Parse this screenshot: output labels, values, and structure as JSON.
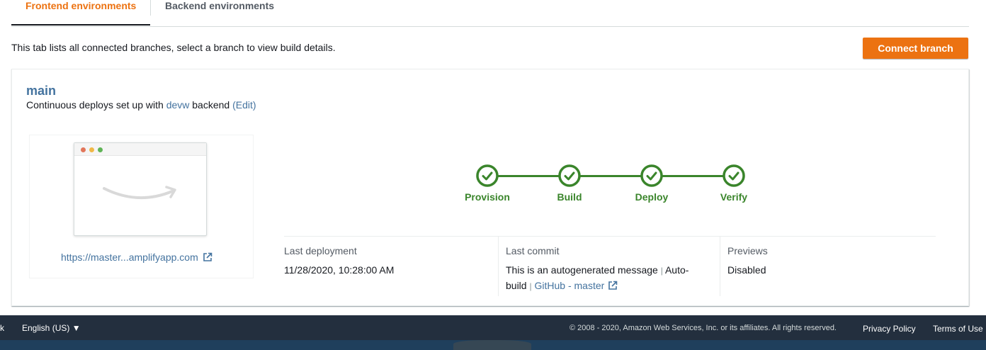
{
  "tabs": {
    "frontend": "Frontend environments",
    "backend": "Backend environments"
  },
  "intro_text": "This tab lists all connected branches, select a branch to view build details.",
  "connect_button": "Connect branch",
  "branch": {
    "name": "main",
    "desc_prefix": "Continuous deploys set up with ",
    "backend_link": "devw",
    "desc_middle": " backend ",
    "edit_link": "(Edit)"
  },
  "preview": {
    "url": "https://master...amplifyapp.com",
    "icon": "external-link-icon"
  },
  "steps": [
    {
      "label": "Provision",
      "status": "complete"
    },
    {
      "label": "Build",
      "status": "complete"
    },
    {
      "label": "Deploy",
      "status": "complete"
    },
    {
      "label": "Verify",
      "status": "complete"
    }
  ],
  "info": {
    "last_deployment_label": "Last deployment",
    "last_deployment_value": "11/28/2020, 10:28:00 AM",
    "last_commit_label": "Last commit",
    "commit_message_1": "This is an autogenerated message",
    "commit_message_2": "Auto-",
    "commit_message_3": "build",
    "commit_repo_link": "GitHub - master",
    "previews_label": "Previews",
    "previews_value": "Disabled"
  },
  "footer": {
    "left_fragment": "k",
    "language": "English (US)",
    "copyright": "© 2008 - 2020, Amazon Web Services, Inc. or its affiliates. All rights reserved.",
    "privacy": "Privacy Policy",
    "terms": "Terms of Use"
  },
  "colors": {
    "accent": "#ec7211",
    "success": "#3a852b",
    "link": "#44739f",
    "footer_bg": "#232f3e"
  }
}
